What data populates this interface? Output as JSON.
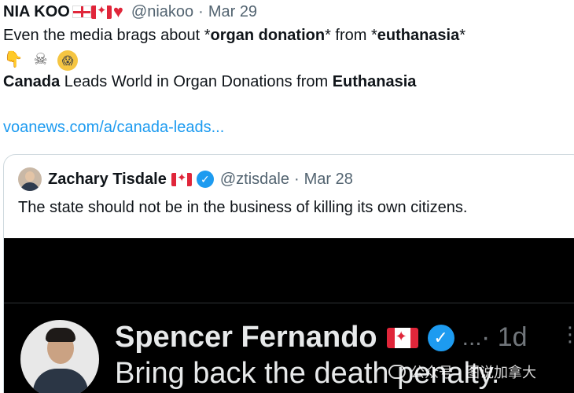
{
  "tweet": {
    "author_name": "NIA KOO",
    "handle": "@niakoo",
    "separator": "·",
    "date": "Mar 29",
    "line1_parts": [
      "Even the media brags about *",
      "organ donation",
      "* from *",
      "euthanasia",
      "*"
    ],
    "emojis": [
      {
        "icon": "pointing-down-icon",
        "glyph": "👇"
      },
      {
        "icon": "skull-crossbones-icon",
        "glyph": "☠"
      },
      {
        "icon": "screaming-face-icon",
        "glyph": "😱"
      }
    ],
    "headline_parts": [
      "Canada",
      " Leads World in Organ Donations from ",
      "Euthanasia"
    ],
    "link": "voanews.com/a/canada-leads..."
  },
  "quoted_tweet": {
    "author_name": "Zachary Tisdale",
    "handle": "@ztisdale",
    "separator": "·",
    "date": "Mar 28",
    "text": "The state should not be in the business of killing its own citizens.",
    "verified_mark": "✓"
  },
  "media": {
    "name": "Spencer Fernando",
    "verified_mark": "✓",
    "dots": "...",
    "time": "· 1d",
    "more": "⋮",
    "text": "Bring back the death penalty."
  },
  "watermark": {
    "text": "公众号 · 图说加拿大"
  },
  "colors": {
    "link": "#1d9bf0",
    "muted": "#536471",
    "flag_red": "#e0263a",
    "verified": "#1d9bf0"
  }
}
